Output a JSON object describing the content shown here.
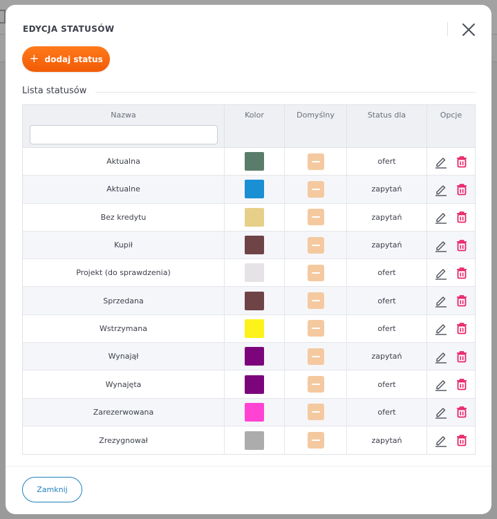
{
  "modal": {
    "title": "EDYCJA STATUSÓW",
    "add_button": {
      "icon": "plus-icon",
      "label": "dodaj status"
    },
    "section_title": "Lista statusów",
    "close_label": "Zamknij"
  },
  "table": {
    "headers": {
      "name": "Nazwa",
      "color": "Kolor",
      "default": "Domyślny",
      "status_for": "Status dla",
      "options": "Opcje"
    },
    "search": {
      "value": "",
      "placeholder": ""
    },
    "rows": [
      {
        "name": "Aktualna",
        "color": "#5a7d6b",
        "status_for": "ofert"
      },
      {
        "name": "Aktualne",
        "color": "#1a8fd4",
        "status_for": "zapytań"
      },
      {
        "name": "Bez kredytu",
        "color": "#e6cf88",
        "status_for": "zapytań"
      },
      {
        "name": "Kupił",
        "color": "#6e4446",
        "status_for": "zapytań"
      },
      {
        "name": "Projekt (do sprawdzenia)",
        "color": "#e5e3e6",
        "status_for": "ofert"
      },
      {
        "name": "Sprzedana",
        "color": "#6e4446",
        "status_for": "ofert"
      },
      {
        "name": "Wstrzymana",
        "color": "#fdf21a",
        "status_for": "ofert"
      },
      {
        "name": "Wynajął",
        "color": "#7c057c",
        "status_for": "zapytań"
      },
      {
        "name": "Wynajęta",
        "color": "#7c057c",
        "status_for": "ofert"
      },
      {
        "name": "Zarezerwowana",
        "color": "#ff44d4",
        "status_for": "ofert"
      },
      {
        "name": "Zrezygnował",
        "color": "#acacac",
        "status_for": "zapytań"
      }
    ]
  },
  "colors": {
    "accent_orange": "#f25b06",
    "default_button": "#f5c9a0",
    "delete_icon": "#e8236a",
    "link_blue": "#1f7fbe"
  },
  "icons": {
    "edit": "pencil-icon",
    "delete": "trash-icon",
    "close": "close-icon"
  }
}
